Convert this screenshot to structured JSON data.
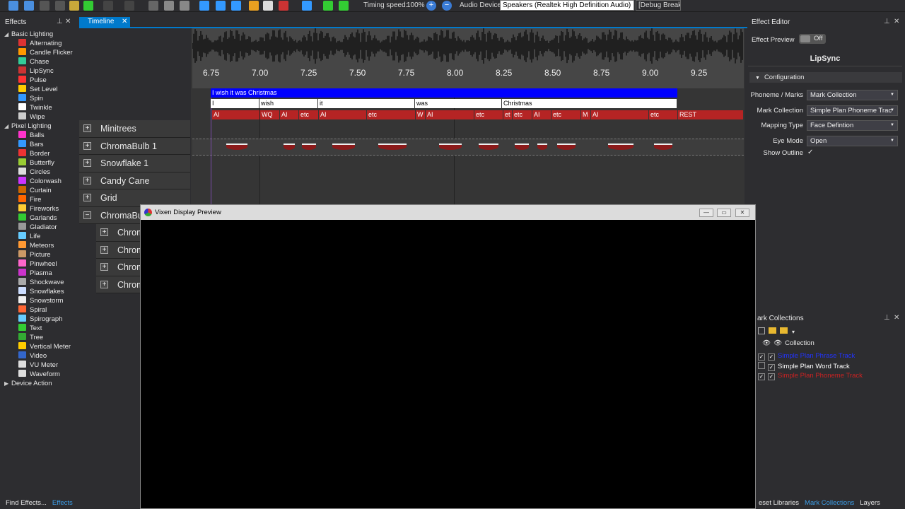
{
  "toolbar": {
    "timing_speed_label": "Timing speed:",
    "timing_speed_value": "100%",
    "audio_device_label": "Audio Device",
    "audio_device_value": "Speakers (Realtek High Definition Audio)",
    "debug_break": "[Debug Break]"
  },
  "effects_panel": {
    "title": "Effects",
    "categories": [
      {
        "label": "Basic Lighting",
        "items": [
          {
            "label": "Alternating",
            "color": "#d33"
          },
          {
            "label": "Candle Flicker",
            "color": "#f90"
          },
          {
            "label": "Chase",
            "color": "#3c9"
          },
          {
            "label": "LipSync",
            "color": "#c33"
          },
          {
            "label": "Pulse",
            "color": "#f33"
          },
          {
            "label": "Set Level",
            "color": "#fc0"
          },
          {
            "label": "Spin",
            "color": "#39f"
          },
          {
            "label": "Twinkle",
            "color": "#fff"
          },
          {
            "label": "Wipe",
            "color": "#ccc"
          }
        ]
      },
      {
        "label": "Pixel Lighting",
        "items": [
          {
            "label": "Balls",
            "color": "#f3c"
          },
          {
            "label": "Bars",
            "color": "#39f"
          },
          {
            "label": "Border",
            "color": "#e33"
          },
          {
            "label": "Butterfly",
            "color": "#9c3"
          },
          {
            "label": "Circles",
            "color": "#ddd"
          },
          {
            "label": "Colorwash",
            "color": "#c3f"
          },
          {
            "label": "Curtain",
            "color": "#c60"
          },
          {
            "label": "Fire",
            "color": "#f60"
          },
          {
            "label": "Fireworks",
            "color": "#fc3"
          },
          {
            "label": "Garlands",
            "color": "#3c3"
          },
          {
            "label": "Gladiator",
            "color": "#999"
          },
          {
            "label": "Life",
            "color": "#6cf"
          },
          {
            "label": "Meteors",
            "color": "#f93"
          },
          {
            "label": "Picture",
            "color": "#c96"
          },
          {
            "label": "Pinwheel",
            "color": "#f6c"
          },
          {
            "label": "Plasma",
            "color": "#c3c"
          },
          {
            "label": "Shockwave",
            "color": "#aaa"
          },
          {
            "label": "Snowflakes",
            "color": "#cdf"
          },
          {
            "label": "Snowstorm",
            "color": "#eee"
          },
          {
            "label": "Spiral",
            "color": "#f63"
          },
          {
            "label": "Spirograph",
            "color": "#6cf"
          },
          {
            "label": "Text",
            "color": "#3c3"
          },
          {
            "label": "Tree",
            "color": "#3a3"
          },
          {
            "label": "Vertical Meter",
            "color": "#fc0"
          },
          {
            "label": "Video",
            "color": "#36c"
          },
          {
            "label": "VU Meter",
            "color": "#ddd"
          },
          {
            "label": "Waveform",
            "color": "#ddd"
          }
        ]
      },
      {
        "label": "Device Action",
        "items": []
      }
    ],
    "bottom_tabs": [
      "Find Effects...",
      "Effects"
    ]
  },
  "timeline": {
    "tab_label": "Timeline",
    "ruler_ticks": [
      "6.75",
      "7.00",
      "7.25",
      "7.50",
      "7.75",
      "8.00",
      "8.25",
      "8.50",
      "8.75",
      "9.00",
      "9.25"
    ],
    "phrase_row": "I wish it was Christmas",
    "word_marks": [
      "I",
      "wish",
      "it",
      "was",
      "Christmas"
    ],
    "phoneme_marks": [
      "AI",
      "WQ",
      "AI",
      "etc",
      "AI",
      "etc",
      "W",
      "AI",
      "etc",
      "et",
      "etc",
      "AI",
      "etc",
      "M",
      "AI",
      "etc",
      "REST"
    ],
    "rows": [
      "Minitrees",
      "ChromaBulb 1",
      "Snowflake 1",
      "Candy Cane",
      "Grid",
      "ChromaBulb"
    ],
    "child_rows": [
      "Chrom",
      "Chrom",
      "Chrom",
      "Chrom"
    ]
  },
  "effect_editor": {
    "title": "Effect Editor",
    "effect_preview_label": "Effect Preview",
    "toggle_value": "Off",
    "effect_name": "LipSync",
    "section": "Configuration",
    "props": [
      {
        "label": "Phoneme / Marks",
        "value": "Mark Collection"
      },
      {
        "label": "Mark Collection",
        "value": "Simple Plan Phoneme Trac"
      },
      {
        "label": "Mapping Type",
        "value": "Face Defintion"
      },
      {
        "label": "Eye Mode",
        "value": "Open"
      }
    ],
    "show_outline_label": "Show Outline",
    "show_outline_check": "✓"
  },
  "mark_collections": {
    "title": "ark Collections",
    "header": "Collection",
    "items": [
      {
        "label": "Simple Plan Phrase Track",
        "color": "#2233ff"
      },
      {
        "label": "Simple Plan Word Track",
        "color": "#ffffff"
      },
      {
        "label": "Simple Plan Phoneme Track",
        "color": "#cc2222"
      }
    ],
    "bottom_tabs": [
      "eset Libraries",
      "Mark Collections",
      "Layers"
    ]
  },
  "preview_window": {
    "title": "Vixen Display Preview"
  }
}
